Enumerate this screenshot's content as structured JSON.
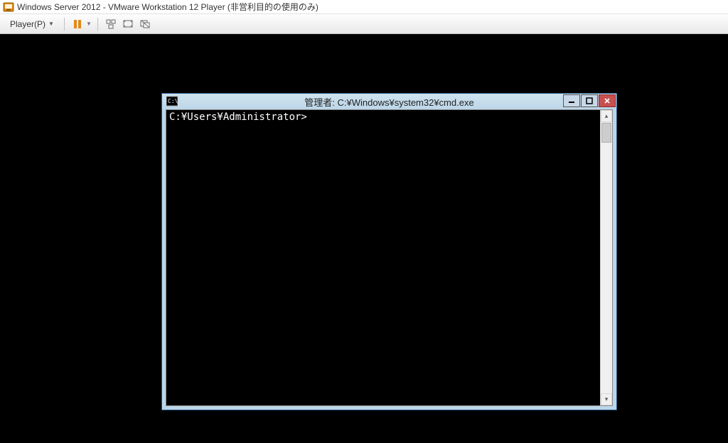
{
  "vmware": {
    "title": "Windows Server 2012 - VMware Workstation 12 Player (非営利目的の使用のみ)",
    "player_menu": "Player(P)"
  },
  "cmd": {
    "title": "管理者: C:¥Windows¥system32¥cmd.exe",
    "prompt": "C:¥Users¥Administrator>"
  },
  "controls": {
    "minimize": "—",
    "close": "✕"
  },
  "scroll": {
    "up": "▴",
    "down": "▾"
  }
}
